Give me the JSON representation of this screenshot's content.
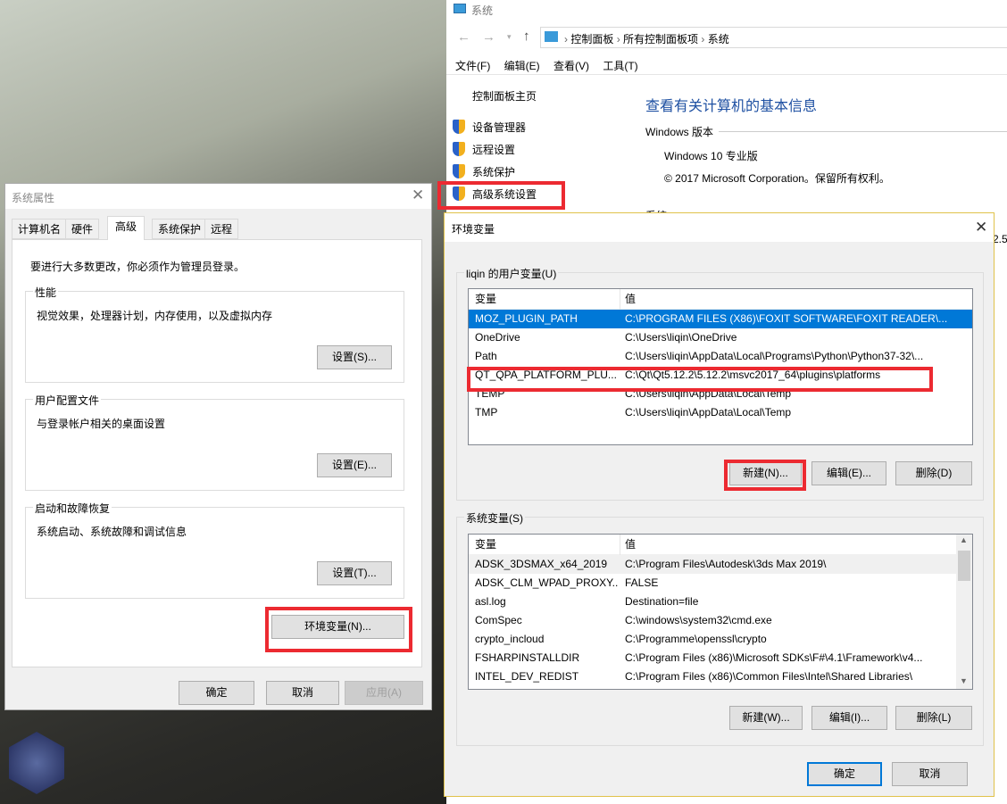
{
  "system_window": {
    "title": "系统",
    "breadcrumb": [
      "控制面板",
      "所有控制面板项",
      "系统"
    ],
    "menu": [
      "文件(F)",
      "编辑(E)",
      "查看(V)",
      "工具(T)"
    ],
    "nav_home": "控制面板主页",
    "nav_items": [
      "设备管理器",
      "远程设置",
      "系统保护",
      "高级系统设置"
    ],
    "heading": "查看有关计算机的基本信息",
    "section_windows": "Windows 版本",
    "edition": "Windows 10 专业版",
    "copyright": "© 2017 Microsoft Corporation。保留所有权利。",
    "section_system": "系统",
    "cut_text": "2.5"
  },
  "sys_props": {
    "title": "系统属性",
    "tabs": [
      "计算机名",
      "硬件",
      "高级",
      "系统保护",
      "远程"
    ],
    "active_tab": "高级",
    "admin_note": "要进行大多数更改，你必须作为管理员登录。",
    "groups": [
      {
        "label": "性能",
        "desc": "视觉效果，处理器计划，内存使用，以及虚拟内存",
        "button": "设置(S)..."
      },
      {
        "label": "用户配置文件",
        "desc": "与登录帐户相关的桌面设置",
        "button": "设置(E)..."
      },
      {
        "label": "启动和故障恢复",
        "desc": "系统启动、系统故障和调试信息",
        "button": "设置(T)..."
      }
    ],
    "env_button": "环境变量(N)...",
    "ok": "确定",
    "cancel": "取消",
    "apply": "应用(A)"
  },
  "env_dialog": {
    "title": "环境变量",
    "user_group": "liqin 的用户变量(U)",
    "col_var": "变量",
    "col_val": "值",
    "user_vars": [
      [
        "MOZ_PLUGIN_PATH",
        "C:\\PROGRAM FILES (X86)\\FOXIT SOFTWARE\\FOXIT READER\\..."
      ],
      [
        "OneDrive",
        "C:\\Users\\liqin\\OneDrive"
      ],
      [
        "Path",
        "C:\\Users\\liqin\\AppData\\Local\\Programs\\Python\\Python37-32\\..."
      ],
      [
        "QT_QPA_PLATFORM_PLU...",
        "C:\\Qt\\Qt5.12.2\\5.12.2\\msvc2017_64\\plugins\\platforms"
      ],
      [
        "TEMP",
        "C:\\Users\\liqin\\AppData\\Local\\Temp"
      ],
      [
        "TMP",
        "C:\\Users\\liqin\\AppData\\Local\\Temp"
      ]
    ],
    "user_buttons": [
      "新建(N)...",
      "编辑(E)...",
      "删除(D)"
    ],
    "sys_group": "系统变量(S)",
    "sys_vars": [
      [
        "ADSK_3DSMAX_x64_2019",
        "C:\\Program Files\\Autodesk\\3ds Max 2019\\"
      ],
      [
        "ADSK_CLM_WPAD_PROXY...",
        "FALSE"
      ],
      [
        "asl.log",
        "Destination=file"
      ],
      [
        "ComSpec",
        "C:\\windows\\system32\\cmd.exe"
      ],
      [
        "crypto_incloud",
        "C:\\Programme\\openssl\\crypto"
      ],
      [
        "FSHARPINSTALLDIR",
        "C:\\Program Files (x86)\\Microsoft SDKs\\F#\\4.1\\Framework\\v4..."
      ],
      [
        "INTEL_DEV_REDIST",
        "C:\\Program Files (x86)\\Common Files\\Intel\\Shared Libraries\\"
      ]
    ],
    "sys_buttons": [
      "新建(W)...",
      "编辑(I)...",
      "删除(L)"
    ],
    "ok": "确定",
    "cancel": "取消"
  },
  "colors": {
    "accent": "#0078d7",
    "highlight": "#ec2a31",
    "heading": "#1e50a2"
  }
}
